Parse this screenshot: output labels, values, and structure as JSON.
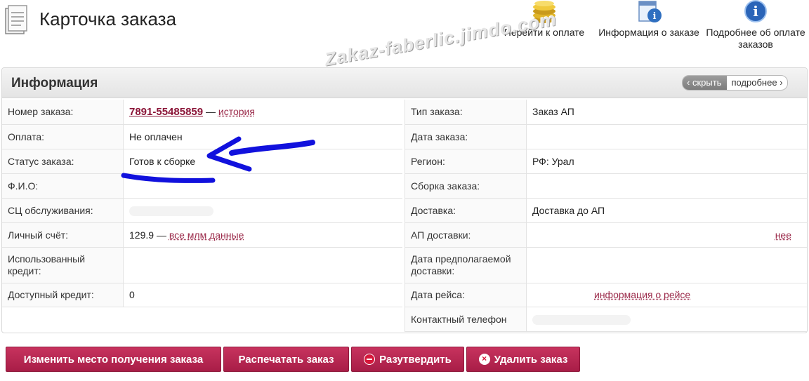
{
  "page": {
    "title": "Карточка заказа"
  },
  "header_actions": [
    {
      "label": "Перейти к оплате",
      "icon": "coins-icon"
    },
    {
      "label": "Информация о заказе",
      "icon": "order-info-icon"
    },
    {
      "label": "Подробнее об оплате заказов",
      "icon": "info-icon"
    }
  ],
  "watermark": "Zakaz-faberlic.jimdo.com",
  "panel": {
    "title": "Информация",
    "toggle": {
      "hide": "скрыть",
      "more": "подробнее"
    }
  },
  "left": {
    "order_number_label": "Номер заказа:",
    "order_number": "7891-55485859",
    "dash": "—",
    "history": "история",
    "payment_label": "Оплата:",
    "payment": "Не оплачен",
    "status_label": "Статус заказа:",
    "status": "Готов к сборке",
    "fio_label": "Ф.И.О:",
    "sc_label": "СЦ обслуживания:",
    "account_label": "Личный счёт:",
    "account": "129.9",
    "mlm_link": "все млм данные",
    "used_credit_label": "Использованный кредит:",
    "available_credit_label": "Доступный кредит:",
    "available_credit": "0"
  },
  "right": {
    "type_label": "Тип заказа:",
    "type": "Заказ АП",
    "date_label": "Дата заказа:",
    "region_label": "Регион:",
    "region": "РФ: Урал",
    "assembly_label": "Сборка заказа:",
    "delivery_label": "Доставка:",
    "delivery": "Доставка до АП",
    "ap_label": "АП доставки:",
    "ap_link": "нее",
    "expected_label": "Дата предполагаемой доставки:",
    "flight_label": "Дата рейса:",
    "flight_link": "информация о рейсе",
    "phone_label": "Контактный телефон"
  },
  "buttons": {
    "change_place": "Изменить место получения заказа",
    "print": "Распечатать заказ",
    "unconfirm": "Разутвердить",
    "delete": "Удалить заказ"
  },
  "colors": {
    "accent": "#b3264f",
    "link": "#8b1538",
    "annotation": "#1111dd"
  }
}
